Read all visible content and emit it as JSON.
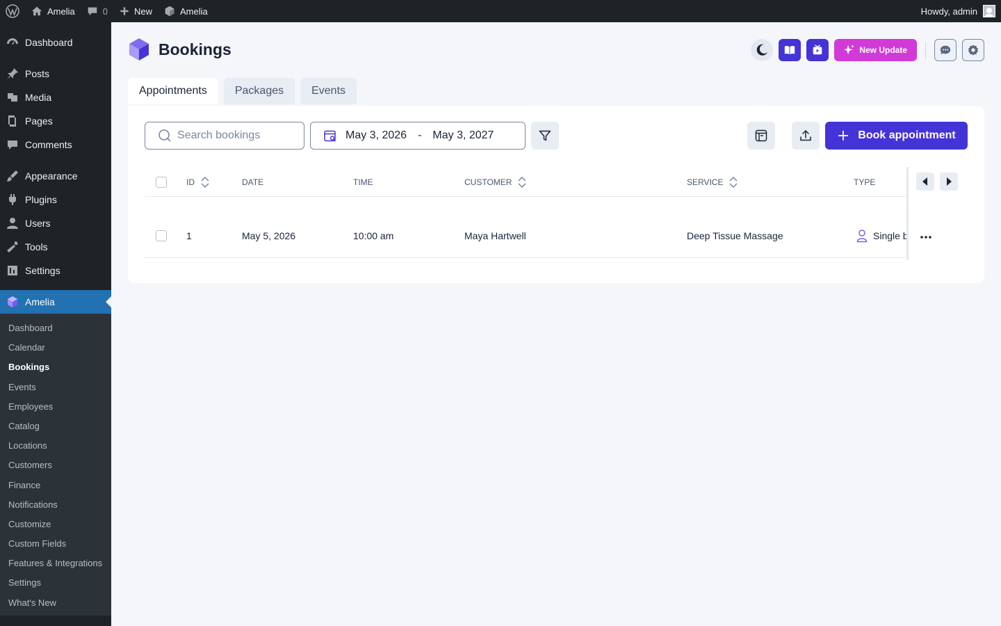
{
  "adminbar": {
    "site_name": "Amelia",
    "comments_count": "0",
    "new_label": "New",
    "plugin_label": "Amelia",
    "howdy": "Howdy, admin"
  },
  "sidebar": {
    "menu": [
      {
        "label": "Dashboard",
        "icon": "dashboard-icon"
      },
      {
        "label": "Posts",
        "icon": "pin-icon"
      },
      {
        "label": "Media",
        "icon": "media-icon"
      },
      {
        "label": "Pages",
        "icon": "pages-icon"
      },
      {
        "label": "Comments",
        "icon": "comment-icon"
      },
      {
        "label": "Appearance",
        "icon": "brush-icon"
      },
      {
        "label": "Plugins",
        "icon": "plug-icon"
      },
      {
        "label": "Users",
        "icon": "user-icon"
      },
      {
        "label": "Tools",
        "icon": "wrench-icon"
      },
      {
        "label": "Settings",
        "icon": "settings-icon"
      }
    ],
    "current": "Amelia",
    "submenu": [
      "Dashboard",
      "Calendar",
      "Bookings",
      "Events",
      "Employees",
      "Catalog",
      "Locations",
      "Customers",
      "Finance",
      "Notifications",
      "Customize",
      "Custom Fields",
      "Features & Integrations",
      "Settings",
      "What's New"
    ],
    "active_submenu": "Bookings"
  },
  "header": {
    "title": "Bookings",
    "new_update": "New Update"
  },
  "tabs": [
    "Appointments",
    "Packages",
    "Events"
  ],
  "toolbar": {
    "search_placeholder": "Search bookings",
    "date_from": "May 3, 2026",
    "date_sep": "-",
    "date_to": "May 3, 2027",
    "book_label": "Book appointment"
  },
  "table": {
    "columns": {
      "id": "ID",
      "date": "DATE",
      "time": "TIME",
      "customer": "CUSTOMER",
      "service": "SERVICE",
      "type": "TYPE"
    },
    "rows": [
      {
        "id": "1",
        "date": "May 5, 2026",
        "time": "10:00 am",
        "customer": "Maya Hartwell",
        "service": "Deep Tissue Massage",
        "type": "Single bo"
      }
    ]
  },
  "colors": {
    "accent": "#4433d6",
    "new_update": "#d23ad7",
    "wp_admin": "#1d2327",
    "wp_current": "#2271b1"
  }
}
